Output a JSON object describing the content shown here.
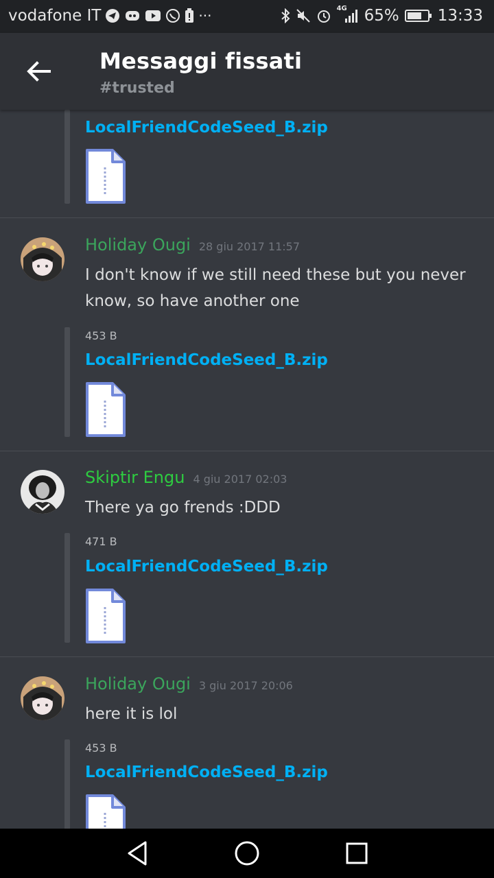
{
  "status_bar": {
    "carrier": "vodafone IT",
    "battery_percent": "65%",
    "time": "13:33",
    "network": "4G",
    "left_icons": [
      "telegram-icon",
      "discord-icon",
      "youtube-icon",
      "whatsapp-icon",
      "battery-alert-icon"
    ],
    "overflow": "···",
    "right_icons": [
      "bluetooth-icon",
      "mute-icon",
      "alarm-icon",
      "signal-icon",
      "battery-icon"
    ]
  },
  "header": {
    "title": "Messaggi fissati",
    "channel": "#trusted",
    "back_icon": "arrow-left-icon"
  },
  "messages": [
    {
      "partial": true,
      "file": {
        "name": "LocalFriendCodeSeed_B.zip",
        "icon": "zip-file-icon"
      }
    },
    {
      "author": "Holiday Ougi",
      "author_color": "#3ba55c",
      "timestamp": "28 giu 2017 11:57",
      "text": "I don't know if we still need these but you never know, so have another one",
      "file": {
        "size": "453 B",
        "name": "LocalFriendCodeSeed_B.zip",
        "icon": "zip-file-icon"
      }
    },
    {
      "author": "Skiptir Engu",
      "author_color": "#2ecc40",
      "timestamp": "4 giu 2017 02:03",
      "text": "There ya go frends :DDD",
      "file": {
        "size": "471 B",
        "name": "LocalFriendCodeSeed_B.zip",
        "icon": "zip-file-icon"
      }
    },
    {
      "author": "Holiday Ougi",
      "author_color": "#3ba55c",
      "timestamp": "3 giu 2017 20:06",
      "text": "here it is lol",
      "file": {
        "size": "453 B",
        "name": "LocalFriendCodeSeed_B.zip",
        "icon": "zip-file-icon"
      }
    }
  ],
  "nav_bar": {
    "back": "triangle-back-icon",
    "home": "circle-home-icon",
    "recents": "square-recents-icon"
  }
}
